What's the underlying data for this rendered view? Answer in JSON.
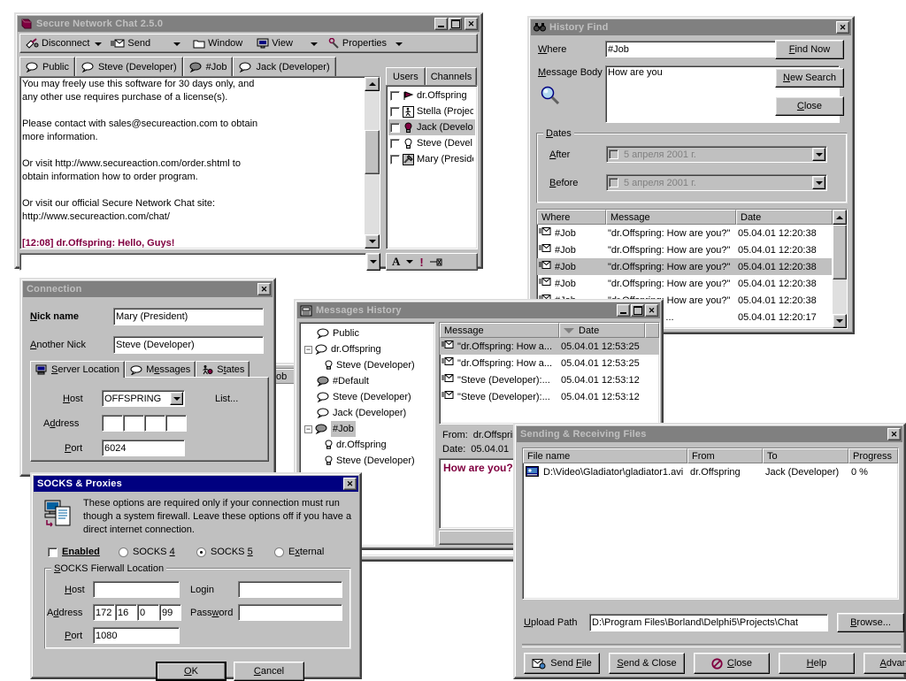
{
  "main_window": {
    "title": "Secure Network Chat 2.5.0",
    "icon": "app-logo-icon",
    "titlebar_buttons": [
      "minimize",
      "maximize",
      "close"
    ],
    "toolbar": [
      {
        "label": "Disconnect",
        "icon": "disconnect-icon",
        "dropdown": true
      },
      {
        "label": "Send",
        "icon": "send-envelope-icon",
        "dropdown": true
      },
      {
        "label": "Window",
        "icon": "folder-icon",
        "dropdown": false
      },
      {
        "label": "View",
        "icon": "monitor-icon",
        "dropdown": true
      },
      {
        "label": "Properties",
        "icon": "wrench-icon",
        "dropdown": true
      }
    ],
    "tabs": [
      {
        "label": "Public",
        "icon": "chat-balloon-icon",
        "selected": true
      },
      {
        "label": "Steve (Developer)",
        "icon": "chat-balloon-icon",
        "selected": false
      },
      {
        "label": "#Job",
        "icon": "channel-balloon-icon",
        "selected": false
      },
      {
        "label": "Jack (Developer)",
        "icon": "chat-balloon-icon",
        "selected": false
      }
    ],
    "chat_lines": [
      {
        "text": "You may freely use this software for 30 days only, and",
        "style": "plain"
      },
      {
        "text": "any other use requires purchase of a license(s).",
        "style": "plain"
      },
      {
        "text": "",
        "style": "plain"
      },
      {
        "text": "Please contact with sales@secureaction.com to obtain",
        "style": "plain"
      },
      {
        "text": "more information.",
        "style": "plain"
      },
      {
        "text": "",
        "style": "plain"
      },
      {
        "text": "Or visit http://www.secureaction.com/order.shtml to",
        "style": "plain"
      },
      {
        "text": "obtain information how to order program.",
        "style": "plain"
      },
      {
        "text": "",
        "style": "plain"
      },
      {
        "text": "Or visit our official Secure Network Chat site:",
        "style": "plain"
      },
      {
        "text": "http://www.secureaction.com/chat/",
        "style": "plain"
      },
      {
        "text": "",
        "style": "plain"
      },
      {
        "text": "[12:08] dr.Offspring: Hello, Guys!",
        "style": "message"
      }
    ],
    "input_value": "",
    "side_tabs": [
      {
        "label": "Users",
        "selected": true
      },
      {
        "label": "Channels",
        "selected": false
      }
    ],
    "users": [
      {
        "name": "dr.Offspring",
        "icon": "user-flag-icon",
        "checked": false,
        "selected": false
      },
      {
        "name": "Stella (Project...",
        "icon": "user-running-icon",
        "checked": false,
        "selected": false
      },
      {
        "name": "Jack (Develo...",
        "icon": "user-bulb-icon",
        "checked": false,
        "selected": true
      },
      {
        "name": "Steve (Devel...",
        "icon": "user-bulb-off-icon",
        "checked": false,
        "selected": false
      },
      {
        "name": "Mary (Preside...",
        "icon": "user-hammer-icon",
        "checked": false,
        "selected": false
      }
    ],
    "format_tools": [
      {
        "icon": "font-A-icon",
        "label": "A"
      },
      {
        "icon": "chevron-down-icon",
        "label": ""
      },
      {
        "icon": "priority-exclamation-icon",
        "label": "!"
      },
      {
        "icon": "pin-icon",
        "label": ""
      }
    ]
  },
  "history_find": {
    "title": "History Find",
    "icon": "binoculars-icon",
    "close_label": "×",
    "where_label": "Where",
    "where_label_accel": "W",
    "where_value": "#Job",
    "message_body_label": "Message Body",
    "message_body_value": "How are you",
    "search_icon": "magnifier-icon",
    "buttons": [
      {
        "label": "Find Now",
        "name": "find-now-button"
      },
      {
        "label": "New Search",
        "name": "new-search-button"
      },
      {
        "label": "Close",
        "name": "close-button"
      }
    ],
    "dates_group": "Dates",
    "after_label": "After",
    "after_value": "5  апреля  2001 г.",
    "after_checked": false,
    "before_label": "Before",
    "before_value": "5  апреля  2001 г.",
    "before_checked": false,
    "columns": [
      "Where",
      "Message",
      "Date"
    ],
    "rows": [
      {
        "where": "#Job",
        "message": "\"dr.Offspring: How are you?\"",
        "date": "05.04.01 12:20:38",
        "selected": false
      },
      {
        "where": "#Job",
        "message": "\"dr.Offspring: How are you?\"",
        "date": "05.04.01 12:20:38",
        "selected": false
      },
      {
        "where": "#Job",
        "message": "\"dr.Offspring: How are you?\"",
        "date": "05.04.01 12:20:38",
        "selected": true
      },
      {
        "where": "#Job",
        "message": "\"dr.Offspring: How are you?\"",
        "date": "05.04.01 12:20:38",
        "selected": false
      },
      {
        "where": "#Job",
        "message": "\"dr.Offspring: How are you?\"",
        "date": "05.04.01 12:20:38",
        "selected": false
      },
      {
        "where": "",
        "message": "t Lead): How ...",
        "date": "05.04.01 12:20:17",
        "selected": false
      }
    ]
  },
  "connection": {
    "title": "Connection",
    "close_label": "×",
    "nick_name_label": "Nick name",
    "nick_name_value": "Mary (President)",
    "another_nick_label": "Another Nick",
    "another_nick_value": "Steve (Developer)",
    "tabs": [
      {
        "label": "Server Location",
        "icon": "server-icon",
        "selected": true
      },
      {
        "label": "Messages",
        "icon": "chat-balloon-icon",
        "selected": false
      },
      {
        "label": "States",
        "icon": "states-icon",
        "selected": false
      }
    ],
    "host_label": "Host",
    "host_value": "OFFSPRING",
    "list_button": "List...",
    "address_label": "Address",
    "address_octets": [
      "",
      "",
      "",
      ""
    ],
    "port_label": "Port",
    "port_value": "6024"
  },
  "messages_history": {
    "title": "Messages History",
    "icon": "history-book-icon",
    "titlebar_buttons": [
      "minimize",
      "maximize",
      "close"
    ],
    "tree": [
      {
        "label": "Public",
        "icon": "chat-balloon-icon",
        "depth": 0,
        "expander": "",
        "selected": false
      },
      {
        "label": "dr.Offspring",
        "icon": "chat-balloon-icon",
        "depth": 0,
        "expander": "-",
        "selected": false
      },
      {
        "label": "Steve (Developer)",
        "icon": "bulb-icon",
        "depth": 1,
        "expander": "",
        "selected": false
      },
      {
        "label": "#Default",
        "icon": "channel-balloon-icon",
        "depth": 0,
        "expander": "",
        "selected": false
      },
      {
        "label": "Steve (Developer)",
        "icon": "chat-balloon-icon",
        "depth": 0,
        "expander": "",
        "selected": false
      },
      {
        "label": "Jack (Developer)",
        "icon": "chat-balloon-icon",
        "depth": 0,
        "expander": "",
        "selected": false
      },
      {
        "label": "#Job",
        "icon": "channel-balloon-icon",
        "depth": 0,
        "expander": "-",
        "selected": true
      },
      {
        "label": "dr.Offspring",
        "icon": "bulb-icon",
        "depth": 1,
        "expander": "",
        "selected": false
      },
      {
        "label": "Steve (Developer)",
        "icon": "bulb-icon",
        "depth": 1,
        "expander": "",
        "selected": false
      }
    ],
    "columns": [
      "Message",
      "Date"
    ],
    "sort_icon": "sort-descending-icon",
    "rows": [
      {
        "message": "\"dr.Offspring: How a...",
        "date": "05.04.01 12:53:25",
        "selected": true
      },
      {
        "message": "\"dr.Offspring: How a...",
        "date": "05.04.01 12:53:25",
        "selected": false
      },
      {
        "message": "\"Steve (Developer):...",
        "date": "05.04.01 12:53:12",
        "selected": false
      },
      {
        "message": "\"Steve (Developer):...",
        "date": "05.04.01 12:53:12",
        "selected": false
      }
    ],
    "from_label": "From:",
    "from_value": "dr.Offspring",
    "date_label": "Date:",
    "date_value": "05.04.01",
    "preview_text": "How are you?"
  },
  "socks": {
    "title": "SOCKS & Proxies",
    "close_label": "×",
    "icon": "proxy-computer-icon",
    "description": "These options are required only if your connection must run though a system firewall. Leave these options off if you have a direct internet connection.",
    "enabled_label": "Enabled",
    "enabled_checked": false,
    "radios": [
      {
        "label": "SOCKS 4",
        "checked": false
      },
      {
        "label": "SOCKS 5",
        "checked": true
      },
      {
        "label": "External",
        "checked": false
      }
    ],
    "group_caption": "SOCKS Fierwall Location",
    "host_label": "Host",
    "host_value": "",
    "address_label": "Address",
    "address_octets": [
      "172",
      "16",
      "0",
      "99"
    ],
    "port_label": "Port",
    "port_value": "1080",
    "login_label": "Login",
    "login_value": "",
    "password_label": "Password",
    "password_value": "",
    "ok_label": "OK",
    "cancel_label": "Cancel"
  },
  "files": {
    "title": "Sending & Receiving Files",
    "close_label": "×",
    "columns": [
      "File name",
      "From",
      "To",
      "Progress"
    ],
    "rows": [
      {
        "icon": "video-file-icon",
        "filename": "D:\\Video\\Gladiator\\gladiator1.avi",
        "from": "dr.Offspring",
        "to": "Jack (Developer)",
        "progress": "0 %"
      }
    ],
    "upload_path_label": "Upload Path",
    "upload_path_value": "D:\\Program Files\\Borland\\Delphi5\\Projects\\Chat",
    "browse_label": "Browse...",
    "buttons": [
      {
        "label": "Send File",
        "icon": "send-file-icon",
        "name": "send-file-button"
      },
      {
        "label": "Send & Close",
        "icon": "",
        "name": "send-and-close-button"
      },
      {
        "label": "Close",
        "icon": "no-entry-icon",
        "name": "close-button"
      },
      {
        "label": "Help",
        "icon": "",
        "name": "help-button"
      },
      {
        "label": "Advanced",
        "icon": "",
        "name": "advanced-button"
      }
    ]
  },
  "background_window": {
    "partial_label": "ob"
  },
  "colors": {
    "face": "#c0c0c0",
    "active_title": "#000080",
    "inactive_title": "#808080",
    "highlight": "#c0c0c0",
    "message_accent": "#800040",
    "window_bg": "#ffffff"
  }
}
